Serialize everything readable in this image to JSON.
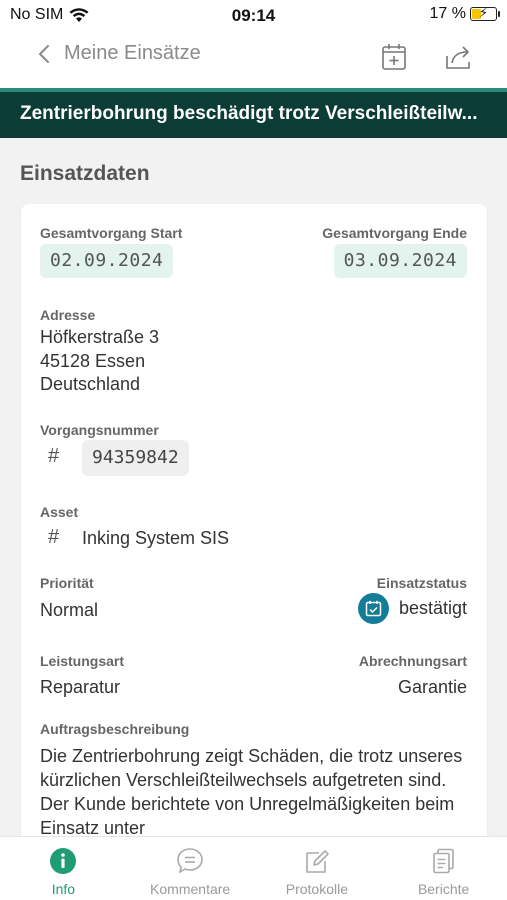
{
  "status_bar": {
    "carrier": "No SIM",
    "time": "09:14",
    "battery": "17 %"
  },
  "nav": {
    "back_label": "Meine Einsätze",
    "icons": [
      "calendar-add-icon",
      "share-icon"
    ]
  },
  "title": "Zentrierbohrung beschädigt trotz Verschleißteilw...",
  "section_title": "Einsatzdaten",
  "fields": {
    "start_label": "Gesamtvorgang Start",
    "start_value": "02.09.2024",
    "end_label": "Gesamtvorgang Ende",
    "end_value": "03.09.2024",
    "address_label": "Adresse",
    "address_line1": "Höfkerstraße 3",
    "address_line2": "45128 Essen",
    "address_line3": "Deutschland",
    "order_number_label": "Vorgangsnummer",
    "order_number_value": "94359842",
    "asset_label": "Asset",
    "asset_value": "Inking System SIS",
    "priority_label": "Priorität",
    "priority_value": "Normal",
    "status_label": "Einsatzstatus",
    "status_value": "bestätigt",
    "service_type_label": "Leistungsart",
    "service_type_value": "Reparatur",
    "billing_type_label": "Abrechnungsart",
    "billing_type_value": "Garantie",
    "description_label": "Auftragsbeschreibung",
    "description_value": "Die Zentrierbohrung zeigt Schäden, die trotz unseres kürzlichen Verschleißteilwechsels aufgetreten sind. Der Kunde berichtete von Unregelmäßigkeiten beim Einsatz unter"
  },
  "tabs": [
    {
      "label": "Info",
      "icon": "info-icon",
      "active": true
    },
    {
      "label": "Kommentare",
      "icon": "comment-icon",
      "active": false
    },
    {
      "label": "Protokolle",
      "icon": "edit-icon",
      "active": false
    },
    {
      "label": "Berichte",
      "icon": "documents-icon",
      "active": false
    }
  ],
  "colors": {
    "header_bg": "#0b3d36",
    "accent": "#1f9c74",
    "status_icon": "#137d97",
    "date_chip": "#e3f4ef"
  }
}
